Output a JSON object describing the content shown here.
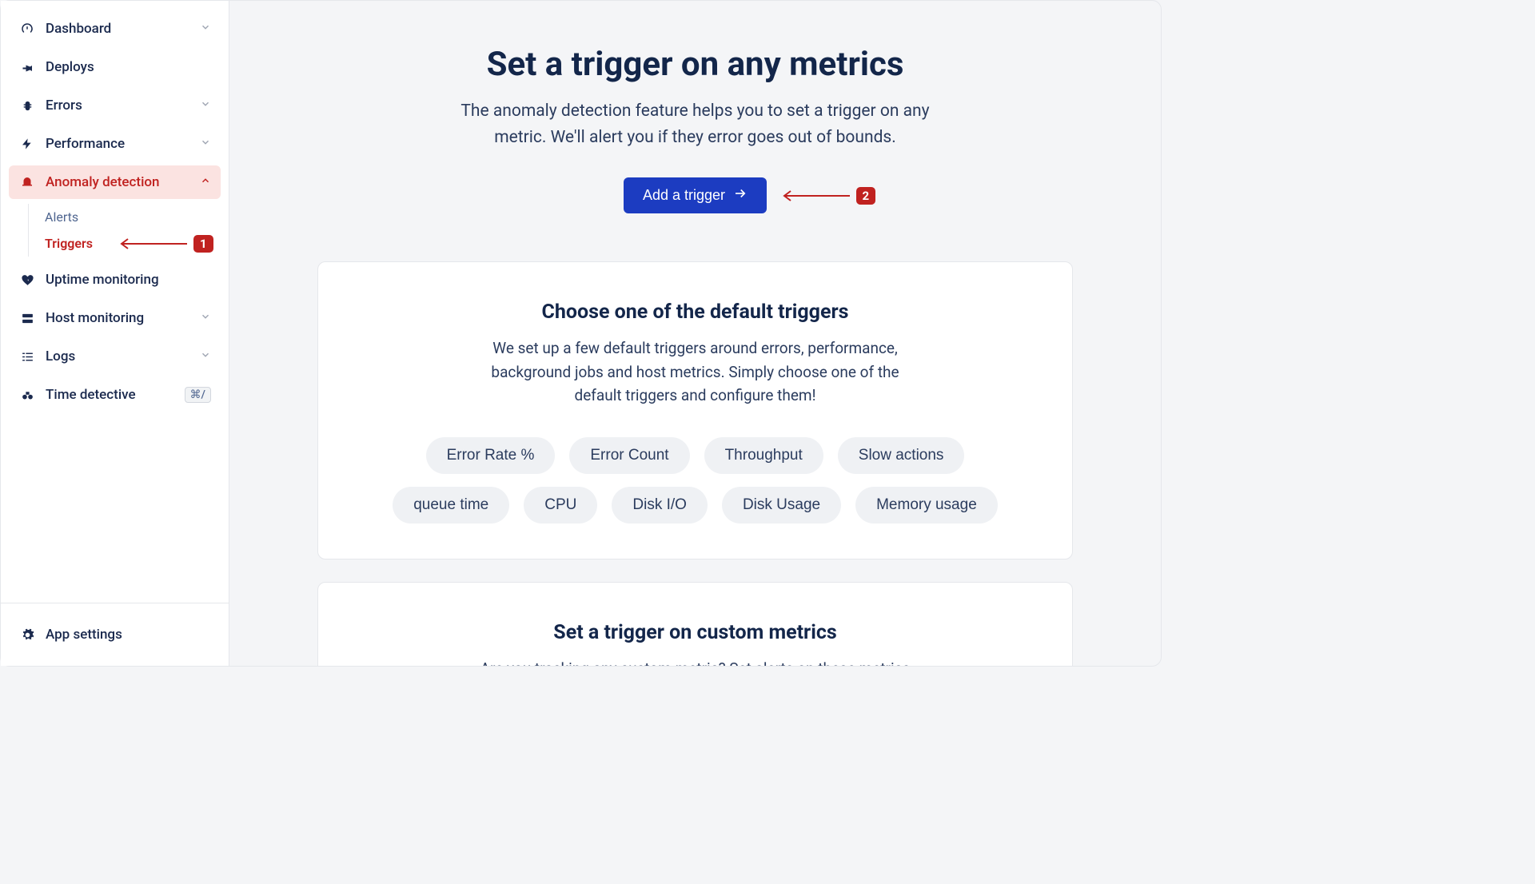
{
  "sidebar": {
    "items": [
      {
        "label": "Dashboard",
        "icon": "gauge",
        "expandable": true
      },
      {
        "label": "Deploys",
        "icon": "rocket",
        "expandable": false
      },
      {
        "label": "Errors",
        "icon": "bug",
        "expandable": true
      },
      {
        "label": "Performance",
        "icon": "bolt",
        "expandable": true
      },
      {
        "label": "Anomaly detection",
        "icon": "alarm",
        "expandable": true,
        "active": true,
        "submenu": [
          {
            "label": "Alerts",
            "active": false
          },
          {
            "label": "Triggers",
            "active": true
          }
        ]
      },
      {
        "label": "Uptime monitoring",
        "icon": "heartbeat",
        "expandable": false
      },
      {
        "label": "Host monitoring",
        "icon": "server",
        "expandable": true
      },
      {
        "label": "Logs",
        "icon": "list",
        "expandable": true
      },
      {
        "label": "Time detective",
        "icon": "binoculars",
        "expandable": false,
        "kbd": "⌘/"
      }
    ],
    "footer": {
      "label": "App settings",
      "icon": "gear"
    }
  },
  "hero": {
    "title": "Set a trigger on any metrics",
    "subtitle": "The anomaly detection feature helps you to set a trigger on any metric. We'll alert you if they error goes out of bounds.",
    "button_label": "Add a trigger"
  },
  "card1": {
    "title": "Choose one of the default triggers",
    "subtitle": "We set up a few default triggers around errors, performance, background jobs and host metrics. Simply choose one of the default triggers and configure them!",
    "chips": [
      "Error Rate %",
      "Error Count",
      "Throughput",
      "Slow actions",
      "queue time",
      "CPU",
      "Disk I/O",
      "Disk Usage",
      "Memory usage"
    ]
  },
  "card2": {
    "title": "Set a trigger on custom metrics",
    "subtitle": "Are you tracking any custom metric? Set alerts on these metrics without any problem. This is useful for getting alerted to metrics that are vital for your application's health."
  },
  "annotations": {
    "a1": "1",
    "a2": "2"
  }
}
